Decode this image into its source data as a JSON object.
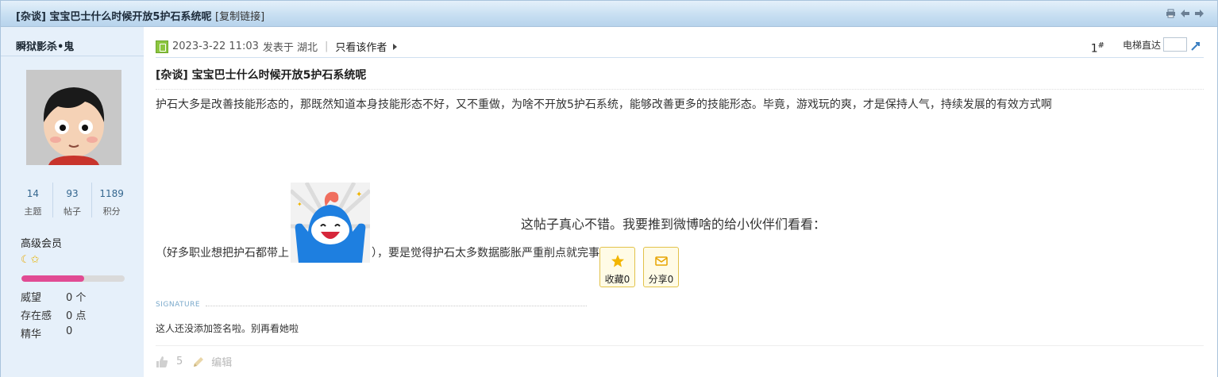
{
  "titlebar": {
    "title": "[杂谈] 宝宝巴士什么时候开放5护石系统呢",
    "copy_link": "[复制链接]",
    "icons": [
      "print-icon",
      "prev-thread-icon",
      "next-thread-icon"
    ]
  },
  "author": {
    "name": "瞬狱影杀•鬼",
    "stats": [
      {
        "value": "14",
        "label": "主题"
      },
      {
        "value": "93",
        "label": "帖子"
      },
      {
        "value": "1189",
        "label": "积分"
      }
    ],
    "rank": "高级会员",
    "level_progress": 0.61,
    "fields": [
      {
        "label": "威望",
        "value": "0 个"
      },
      {
        "label": "存在感",
        "value": "0 点"
      },
      {
        "label": "精华",
        "value": "0"
      }
    ]
  },
  "post": {
    "date": "2023-3-22 11:03",
    "posted_in": "发表于 湖北",
    "only_author": "只看该作者",
    "floor": "1",
    "floor_sup": "#",
    "jump_label": "电梯直达",
    "title": "[杂谈] 宝宝巴士什么时候开放5护石系统呢",
    "body_line1": "护石大多是改善技能形态的，那既然知道本身技能形态不好，又不重做，为啥不开放5护石系统，能够改善更多的技能形态。毕竟，游戏玩的爽，才是保持人气，持续发展的有效方式啊",
    "body_line2_before": "（好多职业想把护石都带上",
    "body_line2_after": "），要是觉得护石太多数据膨胀严重削点就完事了",
    "share_prompt": "这帖子真心不错。我要推到微博啥的给小伙伴们看看：",
    "favorite_label": "收藏0",
    "share_label": "分享0",
    "signature_label": "SIGNATURE",
    "signature_text": "这人还没添加签名啦。别再看她啦",
    "like_count": "5",
    "edit_label": "编辑"
  },
  "colors": {
    "sidebar_bg": "#e6f0fa",
    "titlebar_bg": "#c8dff2",
    "accent": "#35678f",
    "progress_fill": "#e14b93"
  }
}
